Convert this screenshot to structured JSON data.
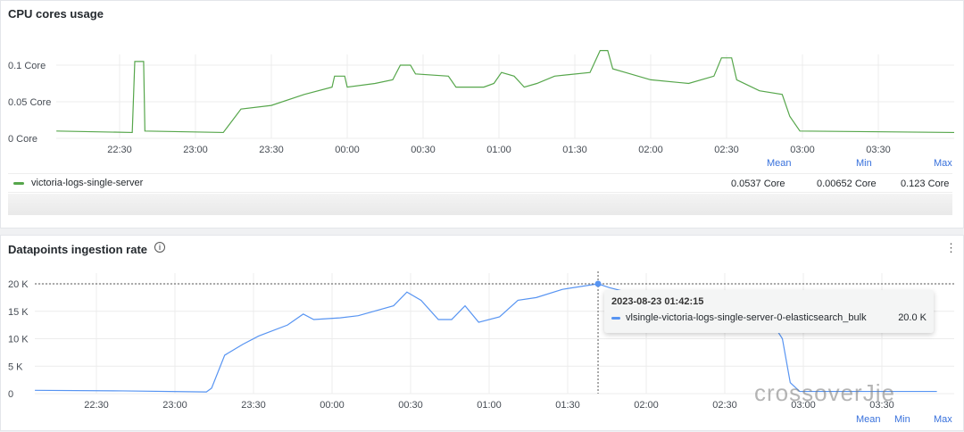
{
  "cpu_panel": {
    "title": "CPU cores usage",
    "legend": {
      "headers": [
        "Mean",
        "Min",
        "Max"
      ],
      "series": "victoria-logs-single-server",
      "mean": "0.0537 Core",
      "min": "0.00652 Core",
      "max": "0.123 Core"
    }
  },
  "ingest_panel": {
    "title": "Datapoints ingestion rate",
    "info_icon": "i",
    "menu_icon": "⋮",
    "legend": {
      "headers": [
        "Mean",
        "Min",
        "Max"
      ]
    },
    "tooltip": {
      "time": "2023-08-23 01:42:15",
      "series": "vlsingle-victoria-logs-single-server-0-elasticsearch_bulk",
      "value": "20.0 K"
    }
  },
  "logo_text": "crossoverJie",
  "chart_data": [
    {
      "type": "line",
      "title": "CPU cores usage",
      "x_unit": "minutes since 22:00",
      "xticks": [
        "22:30",
        "23:00",
        "23:30",
        "00:00",
        "00:30",
        "01:00",
        "01:30",
        "02:00",
        "02:30",
        "03:00",
        "03:30"
      ],
      "yticks": [
        "0 Core",
        "0.05 Core",
        "0.1 Core"
      ],
      "ylim": [
        0,
        0.125
      ],
      "color": "#56a64b",
      "series": [
        {
          "name": "victoria-logs-single-server",
          "points": [
            [
              5,
              0.01
            ],
            [
              35,
              0.008
            ],
            [
              36,
              0.105
            ],
            [
              39.5,
              0.105
            ],
            [
              40,
              0.01
            ],
            [
              71,
              0.008
            ],
            [
              78,
              0.04
            ],
            [
              90,
              0.045
            ],
            [
              103,
              0.06
            ],
            [
              114,
              0.07
            ],
            [
              115,
              0.085
            ],
            [
              119,
              0.085
            ],
            [
              120,
              0.07
            ],
            [
              131,
              0.075
            ],
            [
              138,
              0.08
            ],
            [
              141,
              0.1
            ],
            [
              145,
              0.1
            ],
            [
              147,
              0.088
            ],
            [
              160,
              0.085
            ],
            [
              163,
              0.07
            ],
            [
              174,
              0.07
            ],
            [
              178,
              0.075
            ],
            [
              181,
              0.09
            ],
            [
              186,
              0.085
            ],
            [
              190,
              0.07
            ],
            [
              195,
              0.075
            ],
            [
              202,
              0.085
            ],
            [
              216,
              0.09
            ],
            [
              220,
              0.12
            ],
            [
              223,
              0.12
            ],
            [
              225,
              0.095
            ],
            [
              230,
              0.09
            ],
            [
              240,
              0.08
            ],
            [
              255,
              0.075
            ],
            [
              265,
              0.085
            ],
            [
              268,
              0.11
            ],
            [
              272,
              0.11
            ],
            [
              274,
              0.08
            ],
            [
              283,
              0.065
            ],
            [
              292,
              0.06
            ],
            [
              295,
              0.03
            ],
            [
              299,
              0.01
            ],
            [
              360,
              0.008
            ]
          ]
        }
      ]
    },
    {
      "type": "line",
      "title": "Datapoints ingestion rate",
      "x_unit": "minutes since 22:00",
      "xticks": [
        "22:30",
        "23:00",
        "23:30",
        "00:00",
        "00:30",
        "01:00",
        "01:30",
        "02:00",
        "02:30",
        "03:00",
        "03:30"
      ],
      "yticks": [
        "0",
        "5 K",
        "10 K",
        "15 K",
        "20 K"
      ],
      "ylim": [
        0,
        20000
      ],
      "color": "#5794f2",
      "series": [
        {
          "name": "vlsingle-victoria-logs-single-server-0-elasticsearch_bulk",
          "points": [
            [
              6.5,
              600
            ],
            [
              40,
              500
            ],
            [
              72,
              300
            ],
            [
              74,
              1000
            ],
            [
              79,
              7000
            ],
            [
              86,
              9000
            ],
            [
              92,
              10500
            ],
            [
              103,
              12500
            ],
            [
              109,
              14500
            ],
            [
              113,
              13500
            ],
            [
              123,
              13800
            ],
            [
              130,
              14200
            ],
            [
              143.5,
              16000
            ],
            [
              148.6,
              18500
            ],
            [
              154,
              17000
            ],
            [
              160.6,
              13500
            ],
            [
              165.7,
              13500
            ],
            [
              170.8,
              16000
            ],
            [
              176,
              13000
            ],
            [
              184,
              14000
            ],
            [
              191,
              17000
            ],
            [
              198,
              17500
            ],
            [
              208,
              19000
            ],
            [
              221.6,
              20000
            ],
            [
              226,
              19300
            ],
            [
              290,
              11500
            ],
            [
              292,
              10000
            ],
            [
              295,
              2000
            ],
            [
              298.6,
              400
            ],
            [
              351,
              400
            ]
          ]
        }
      ]
    }
  ]
}
